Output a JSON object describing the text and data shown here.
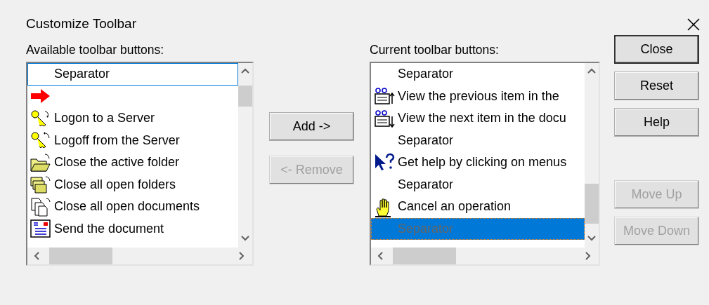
{
  "window": {
    "title": "Customize Toolbar"
  },
  "available": {
    "label": "Available toolbar buttons:",
    "items": [
      {
        "kind": "separator",
        "text": "Separator",
        "selected": false,
        "focused": true
      },
      {
        "kind": "arrow",
        "selected": false,
        "focused": false
      },
      {
        "kind": "key-logon",
        "text": "Logon to a Server",
        "selected": false,
        "focused": false
      },
      {
        "kind": "key-logoff",
        "text": "Logoff from the Server",
        "selected": false,
        "focused": false
      },
      {
        "kind": "folder",
        "text": "Close the active folder",
        "selected": false,
        "focused": false
      },
      {
        "kind": "folders",
        "text": "Close all open folders",
        "selected": false,
        "focused": false
      },
      {
        "kind": "documents",
        "text": "Close all open documents",
        "selected": false,
        "focused": false
      },
      {
        "kind": "send",
        "text": "Send the document",
        "selected": false,
        "focused": false
      }
    ]
  },
  "transfer_buttons": [
    {
      "label": "Add ->",
      "disabled": false
    },
    {
      "label": "<- Remove",
      "disabled": true
    }
  ],
  "current": {
    "label": "Current toolbar buttons:",
    "items": [
      {
        "kind": "separator",
        "text": "Separator",
        "selected": false,
        "focused": false
      },
      {
        "kind": "view-prev",
        "text": "View the previous item in the",
        "selected": false,
        "focused": false
      },
      {
        "kind": "view-next",
        "text": "View the next item in the docu",
        "selected": false,
        "focused": false
      },
      {
        "kind": "separator",
        "text": "Separator",
        "selected": false,
        "focused": false
      },
      {
        "kind": "help",
        "text": "Get help by clicking on menus",
        "selected": false,
        "focused": false
      },
      {
        "kind": "separator",
        "text": "Separator",
        "selected": false,
        "focused": false
      },
      {
        "kind": "hand",
        "text": "Cancel an operation",
        "selected": false,
        "focused": false
      },
      {
        "kind": "separator",
        "text": "Separator",
        "selected": true,
        "focused": true
      }
    ]
  },
  "side_buttons": [
    {
      "label": "Close",
      "default": true,
      "disabled": false
    },
    {
      "label": "Reset",
      "default": false,
      "disabled": false
    },
    {
      "label": "Help",
      "default": false,
      "disabled": false
    }
  ],
  "move_buttons": [
    {
      "label": "Move Up",
      "disabled": true
    },
    {
      "label": "Move Down",
      "disabled": true
    }
  ]
}
